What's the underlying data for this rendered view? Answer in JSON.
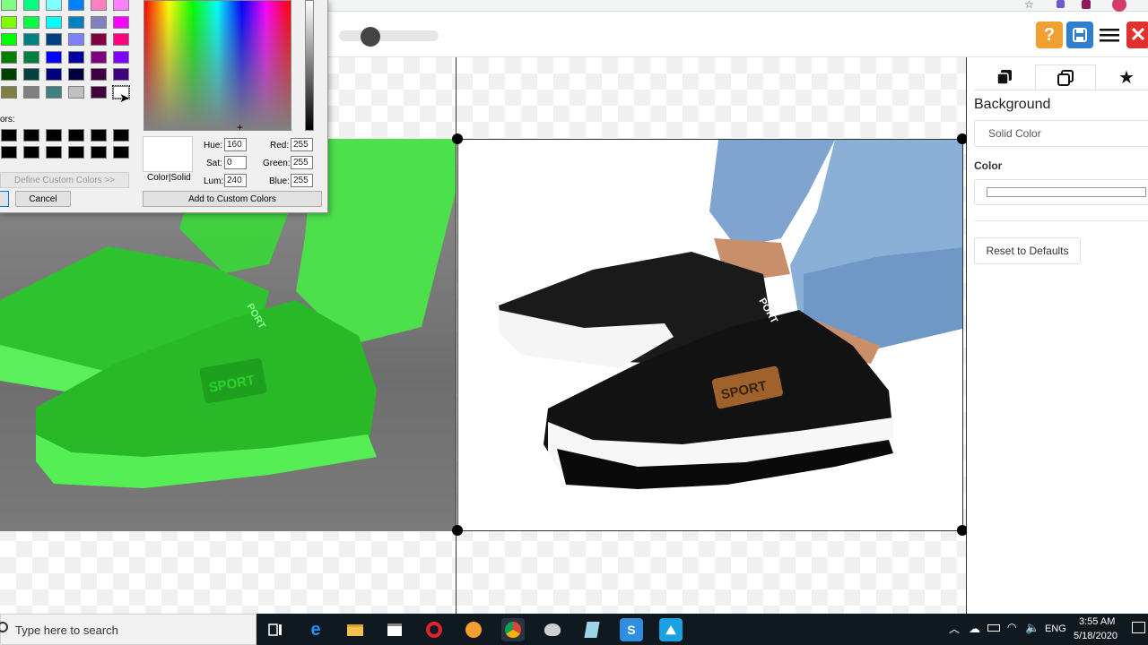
{
  "color_dialog": {
    "custom_colors_label": "ors:",
    "define_custom_label": "Define Custom Colors >>",
    "ok_label": "",
    "cancel_label": "Cancel",
    "color_solid_label": "Color|Solid",
    "hue_label": "Hue:",
    "hue_value": "160",
    "sat_label": "Sat:",
    "sat_value": "0",
    "lum_label": "Lum:",
    "lum_value": "240",
    "red_label": "Red:",
    "red_value": "255",
    "green_label": "Green:",
    "green_value": "255",
    "blue_label": "Blue:",
    "blue_value": "255",
    "add_custom_label": "Add to Custom Colors",
    "swatches": [
      [
        "#80ff80",
        "#00ff80",
        "#80ffff",
        "#0080ff",
        "#ff80c0",
        "#ff80ff"
      ],
      [
        "#80ff00",
        "#00ff40",
        "#00ffff",
        "#0080c0",
        "#8080c0",
        "#ff00ff"
      ],
      [
        "#00ff00",
        "#008080",
        "#004080",
        "#8080ff",
        "#800040",
        "#ff0080"
      ],
      [
        "#008000",
        "#008040",
        "#0000ff",
        "#0000a0",
        "#800080",
        "#8000ff"
      ],
      [
        "#004000",
        "#004040",
        "#000080",
        "#000040",
        "#400040",
        "#400080"
      ],
      [
        "#808040",
        "#808080",
        "#408080",
        "#c0c0c0",
        "#400040",
        "#ffffff"
      ]
    ]
  },
  "toolbar": {
    "help_icon": "?",
    "colors": {
      "help": "#f0a030",
      "save": "#2f7fd0",
      "close": "#e0302f"
    }
  },
  "panel": {
    "section_title": "Background",
    "fill_type": "Solid Color",
    "color_label": "Color",
    "color_value": "#ffffff",
    "reset_label": "Reset to Defaults"
  },
  "images": {
    "left_badge": "SPORT",
    "left_tongue": "PORT",
    "right_badge": "SPORT",
    "right_tongue": "PORT"
  },
  "taskbar": {
    "search_placeholder": "Type here to search",
    "language": "ENG",
    "time": "3:55 AM",
    "date": "5/18/2020"
  }
}
